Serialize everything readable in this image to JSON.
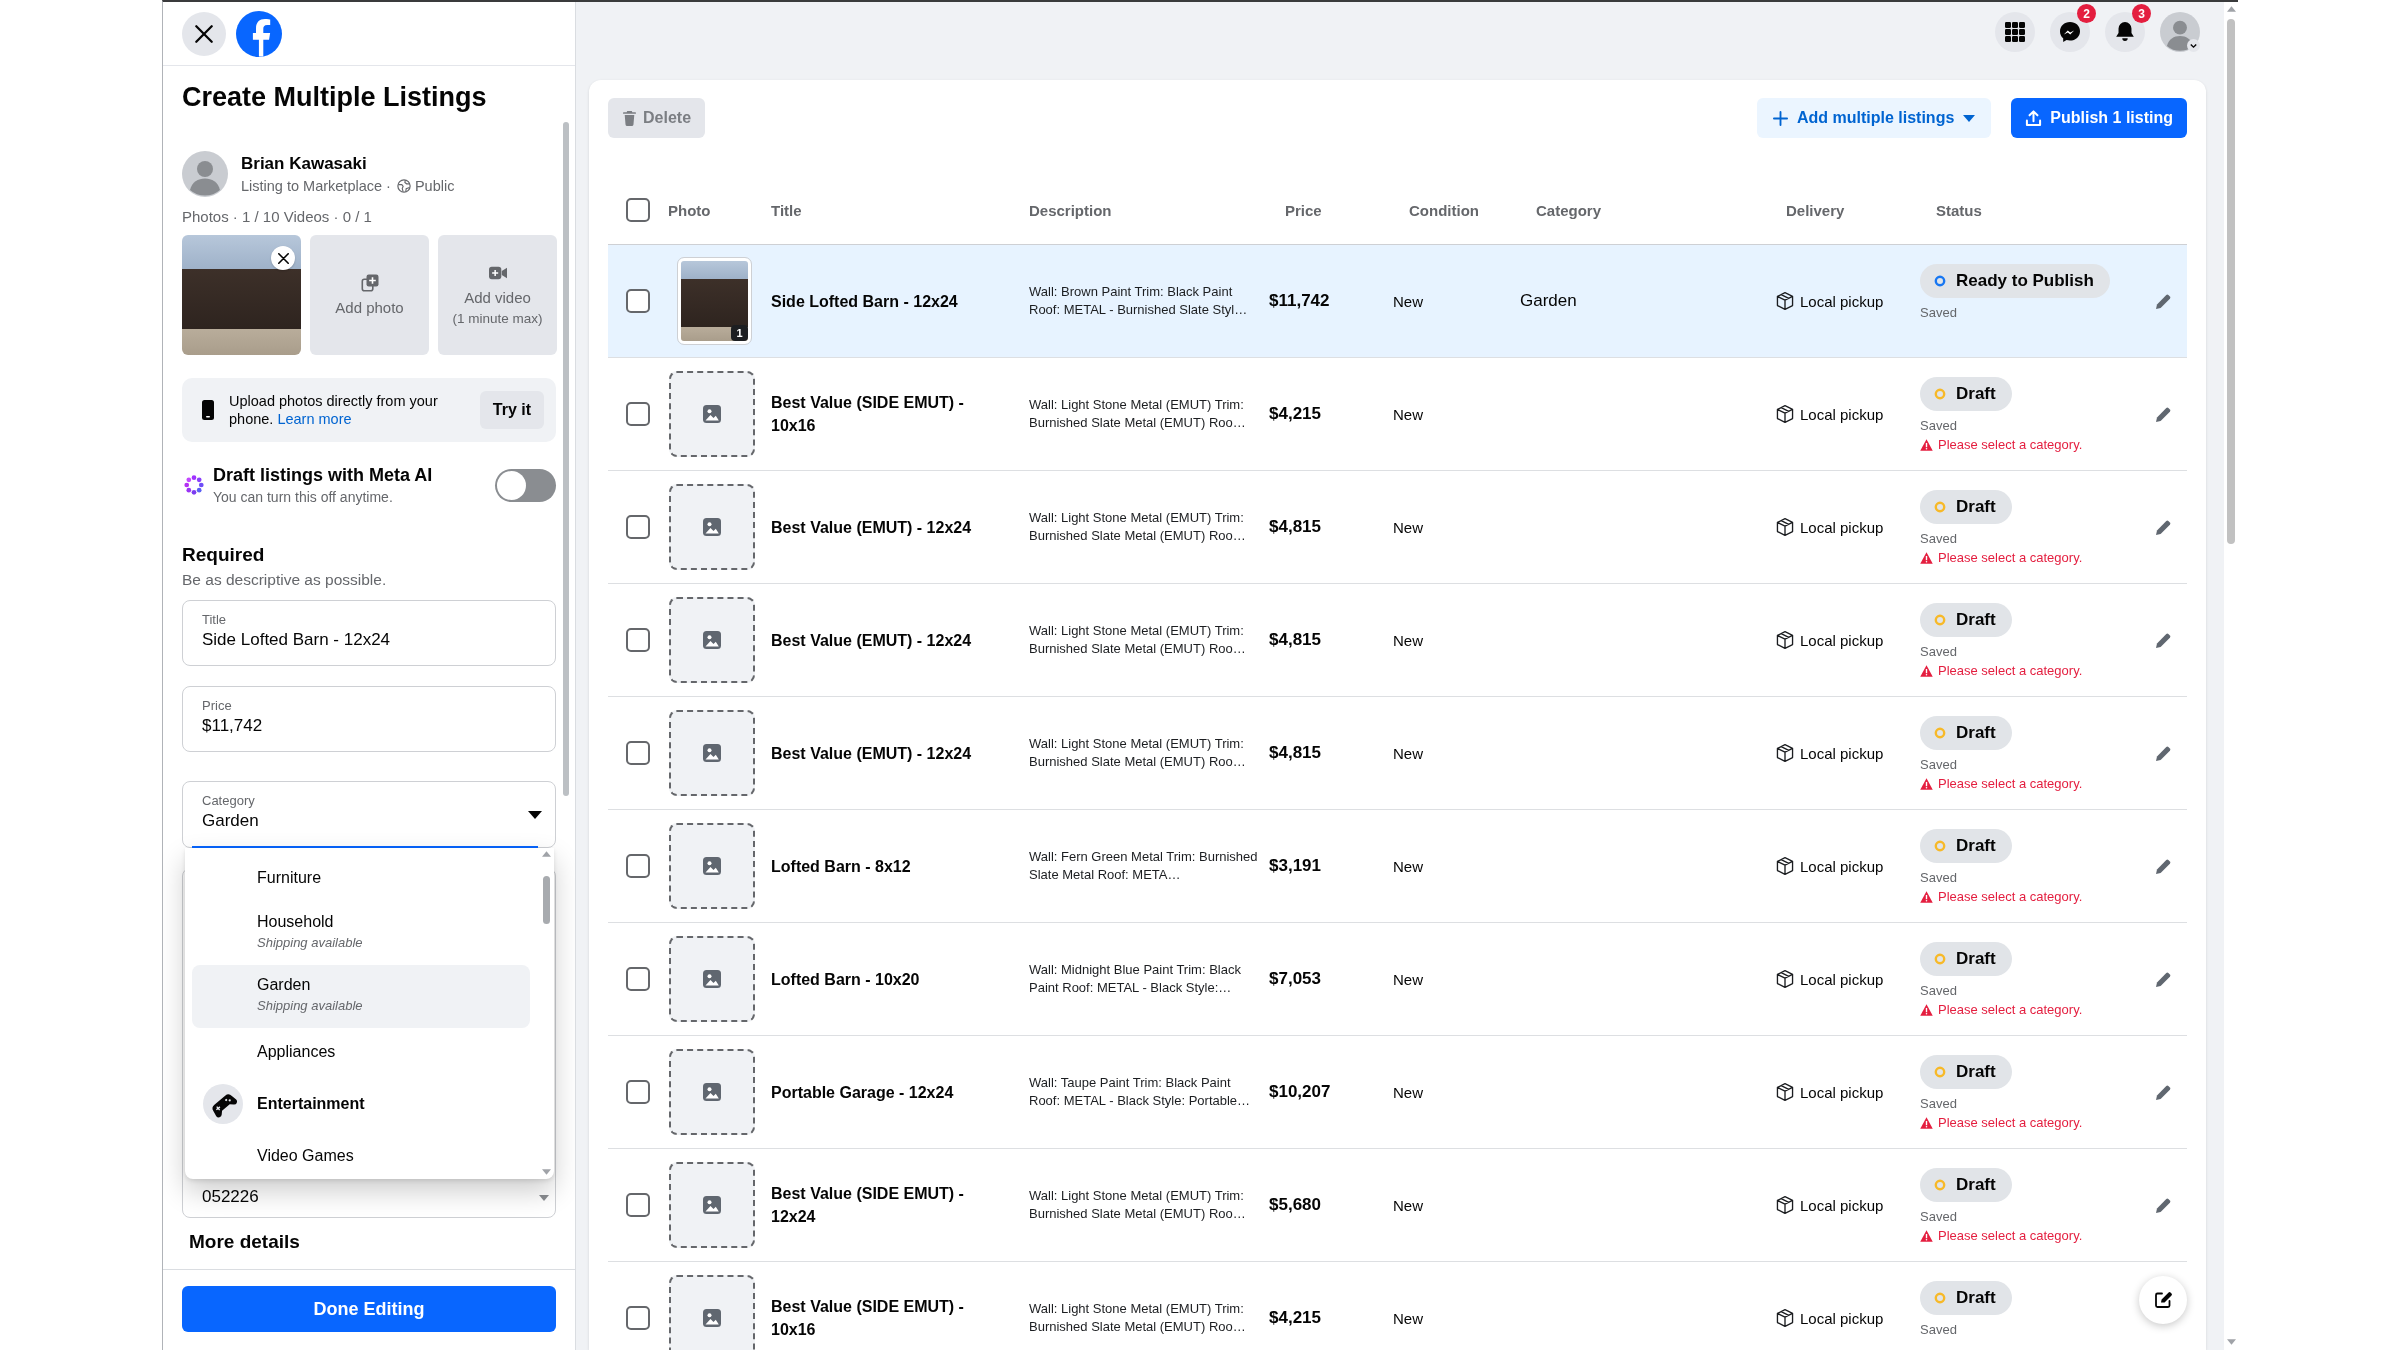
{
  "top_bar": {
    "icons": [
      {
        "kind": "apps"
      },
      {
        "kind": "chat",
        "badge": "2"
      },
      {
        "kind": "notifications",
        "badge": "3"
      },
      {
        "kind": "account"
      }
    ]
  },
  "sidebar": {
    "title": "Create Multiple Listings",
    "seller": {
      "name": "Brian Kawasaki",
      "subtitle": "Listing to Marketplace ·",
      "audience": "Public"
    },
    "media_count": "Photos · 1 / 10 Videos · 0 / 1",
    "media_tiles": [
      {
        "kind": "photo"
      },
      {
        "kind": "add_photo",
        "label": "Add photo"
      },
      {
        "kind": "add_video",
        "label": "Add video",
        "note": "(1 minute max)"
      }
    ],
    "upload_hint": {
      "text": "Upload photos directly from your phone.",
      "link": "Learn more",
      "button": "Try it"
    },
    "meta_ai": {
      "title": "Draft listings with Meta AI",
      "subtitle": "You can turn this off anytime.",
      "on": false
    },
    "required": {
      "heading": "Required",
      "hint": "Be as descriptive as possible."
    },
    "fields": [
      {
        "label": "Title",
        "value": "Side Lofted Barn - 12x24"
      },
      {
        "label": "Price",
        "value": "$11,742"
      }
    ],
    "category": {
      "label": "Category",
      "value": "Garden",
      "expanded": true,
      "options": [
        {
          "kind": "option",
          "label": "Furniture",
          "selected": false
        },
        {
          "kind": "option",
          "label": "Household",
          "note": "Shipping available",
          "selected": false
        },
        {
          "kind": "option",
          "label": "Garden",
          "note": "Shipping available",
          "selected": true
        },
        {
          "kind": "option",
          "label": "Appliances",
          "selected": false
        },
        {
          "kind": "group",
          "label": "Entertainment",
          "selected": false
        },
        {
          "kind": "option",
          "label": "Video Games",
          "selected": false
        }
      ]
    },
    "text_area": {
      "value": "052226"
    },
    "more_details": "More details",
    "done_button": "Done Editing"
  },
  "toolbar": {
    "delete_button": {
      "label": "Delete",
      "disabled": true
    },
    "add_button": "Add multiple listings",
    "publish_button": "Publish 1 listing"
  },
  "table": {
    "select_all_checked": false,
    "columns": [
      "Photo",
      "Title",
      "Description",
      "Price",
      "Condition",
      "Category",
      "Delivery",
      "Status"
    ],
    "rows": [
      {
        "selected": true,
        "checked": false,
        "has_photo": true,
        "photo_count": "1",
        "title": "Side Lofted Barn - 12x24",
        "description": "Wall: Brown Paint Trim: Black Paint Roof: METAL - Burnished Slate Styl…",
        "price": "$11,742",
        "condition": "New",
        "category": "Garden",
        "delivery": "Local pickup",
        "status": {
          "label": "Ready to Publish",
          "color": "#1877f2"
        },
        "saved": "Saved"
      },
      {
        "selected": false,
        "checked": false,
        "has_photo": false,
        "title": "Best Value (SIDE EMUT) - 10x16",
        "description": "Wall: Light Stone Metal (EMUT) Trim: Burnished Slate Metal (EMUT) Roo…",
        "price": "$4,215",
        "condition": "New",
        "delivery": "Local pickup",
        "status": {
          "label": "Draft",
          "color": "#f7b928"
        },
        "saved": "Saved",
        "warning": "Please select a category."
      },
      {
        "selected": false,
        "checked": false,
        "has_photo": false,
        "title": "Best Value (EMUT) - 12x24",
        "description": "Wall: Light Stone Metal (EMUT) Trim: Burnished Slate Metal (EMUT) Roo…",
        "price": "$4,815",
        "condition": "New",
        "delivery": "Local pickup",
        "status": {
          "label": "Draft",
          "color": "#f7b928"
        },
        "saved": "Saved",
        "warning": "Please select a category."
      },
      {
        "selected": false,
        "checked": false,
        "has_photo": false,
        "title": "Best Value (EMUT) - 12x24",
        "description": "Wall: Light Stone Metal (EMUT) Trim: Burnished Slate Metal (EMUT) Roo…",
        "price": "$4,815",
        "condition": "New",
        "delivery": "Local pickup",
        "status": {
          "label": "Draft",
          "color": "#f7b928"
        },
        "saved": "Saved",
        "warning": "Please select a category."
      },
      {
        "selected": false,
        "checked": false,
        "has_photo": false,
        "title": "Best Value (EMUT) - 12x24",
        "description": "Wall: Light Stone Metal (EMUT) Trim: Burnished Slate Metal (EMUT) Roo…",
        "price": "$4,815",
        "condition": "New",
        "delivery": "Local pickup",
        "status": {
          "label": "Draft",
          "color": "#f7b928"
        },
        "saved": "Saved",
        "warning": "Please select a category."
      },
      {
        "selected": false,
        "checked": false,
        "has_photo": false,
        "title": "Lofted Barn - 8x12",
        "description": "Wall: Fern Green Metal Trim: Burnished Slate Metal Roof: META…",
        "price": "$3,191",
        "condition": "New",
        "delivery": "Local pickup",
        "status": {
          "label": "Draft",
          "color": "#f7b928"
        },
        "saved": "Saved",
        "warning": "Please select a category."
      },
      {
        "selected": false,
        "checked": false,
        "has_photo": false,
        "title": "Lofted Barn - 10x20",
        "description": "Wall: Midnight Blue Paint Trim: Black Paint Roof: METAL - Black Style:…",
        "price": "$7,053",
        "condition": "New",
        "delivery": "Local pickup",
        "status": {
          "label": "Draft",
          "color": "#f7b928"
        },
        "saved": "Saved",
        "warning": "Please select a category."
      },
      {
        "selected": false,
        "checked": false,
        "has_photo": false,
        "title": "Portable Garage - 12x24",
        "description": "Wall: Taupe Paint Trim: Black Paint Roof: METAL - Black Style: Portable…",
        "price": "$10,207",
        "condition": "New",
        "delivery": "Local pickup",
        "status": {
          "label": "Draft",
          "color": "#f7b928"
        },
        "saved": "Saved",
        "warning": "Please select a category."
      },
      {
        "selected": false,
        "checked": false,
        "has_photo": false,
        "title": "Best Value (SIDE EMUT) - 12x24",
        "description": "Wall: Light Stone Metal (EMUT) Trim: Burnished Slate Metal (EMUT) Roo…",
        "price": "$5,680",
        "condition": "New",
        "delivery": "Local pickup",
        "status": {
          "label": "Draft",
          "color": "#f7b928"
        },
        "saved": "Saved",
        "warning": "Please select a category."
      },
      {
        "selected": false,
        "checked": false,
        "has_photo": false,
        "title": "Best Value (SIDE EMUT) - 10x16",
        "description": "Wall: Light Stone Metal (EMUT) Trim: Burnished Slate Metal (EMUT) Roo…",
        "price": "$4,215",
        "condition": "New",
        "delivery": "Local pickup",
        "status": {
          "label": "Draft",
          "color": "#f7b928"
        },
        "saved": "Saved"
      }
    ]
  }
}
